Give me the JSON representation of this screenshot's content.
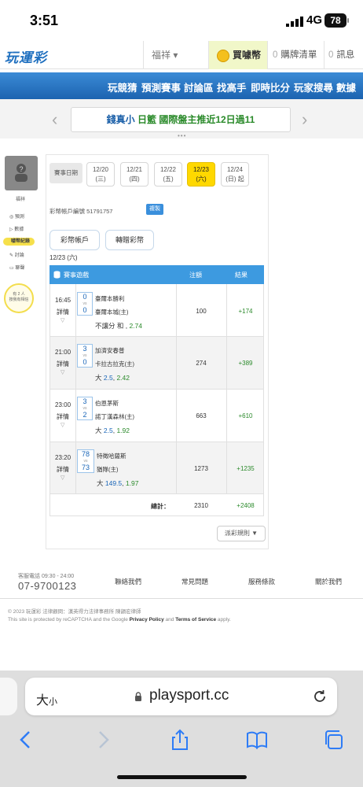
{
  "status_bar": {
    "time": "3:51",
    "network": "4G",
    "battery": "78"
  },
  "header": {
    "logo": "玩運彩",
    "user": "福祥 ▾",
    "buy_label": "買噱幣",
    "cart_count": "0",
    "cart_label": "購牌清單",
    "msg_count": "0",
    "msg_label": "訊息"
  },
  "nav": [
    "玩競猜",
    "預測賽事",
    "討論區",
    "找高手",
    "即時比分",
    "玩家搜尋",
    "數據"
  ],
  "banner": {
    "part1": "錢真小",
    "part2": " 日籃 國際盤主推近12日過11"
  },
  "sidebar": {
    "name": "福祥",
    "items": [
      "預測",
      "數據",
      "噱幣紀錄",
      "討論",
      "聊聲"
    ],
    "bulb_line1": "有 2 人",
    "bulb_line2": "按我有相信"
  },
  "content": {
    "tab_label": "賽事日期",
    "dates": [
      {
        "date": "12/20",
        "day": "(三)"
      },
      {
        "date": "12/21",
        "day": "(四)"
      },
      {
        "date": "12/22",
        "day": "(五)"
      },
      {
        "date": "12/23",
        "day": "(六)"
      },
      {
        "date": "12/24",
        "day": "(日) 起"
      }
    ],
    "account_label": "彩幣帳戶編號 51791757",
    "copy_label": "複製",
    "wallet_tabs": [
      "彩幣帳戶",
      "轉贈彩幣"
    ],
    "selected_date": "12/23 (六)",
    "table_headers": {
      "game": "賽事遊戲",
      "amount": "注額",
      "result": "結果"
    },
    "rows": [
      {
        "time": "16:45",
        "detail": "詳情",
        "score_a": "0",
        "score_b": "0",
        "team_a": "臺爾本勝利",
        "team_b": "臺爾本城(主)",
        "pick_label": "不讓分 和 , ",
        "pick_value": "2.74",
        "pick_line": "",
        "amount": "100",
        "result": "+174"
      },
      {
        "time": "21:00",
        "detail": "詳情",
        "score_a": "3",
        "score_b": "0",
        "team_a": "加濟安春普",
        "team_b": "卡拉古拉克(主)",
        "pick_label": "大 ",
        "pick_line": "2.5",
        "pick_value": "2.42",
        "amount": "274",
        "result": "+389"
      },
      {
        "time": "23:00",
        "detail": "詳情",
        "score_a": "3",
        "score_b": "2",
        "team_a": "伯恩茅斯",
        "team_b": "諾丁漢森林(主)",
        "pick_label": "大 ",
        "pick_line": "2.5",
        "pick_value": "1.92",
        "amount": "663",
        "result": "+610"
      },
      {
        "time": "23:20",
        "detail": "詳情",
        "score_a": "78",
        "score_b": "73",
        "team_a": "特徵哈薩斯",
        "team_b": "猶隊(主)",
        "pick_label": "大 ",
        "pick_line": "149.5",
        "pick_value": "1.97",
        "amount": "1273",
        "result": "+1235"
      }
    ],
    "total_label": "總計：",
    "total_amount": "2310",
    "total_result": "+2408",
    "rules_label": "派彩規則 ▼"
  },
  "footer": {
    "phone_label": "客服電話 09:30 - 24:00",
    "phone": "07-9700123",
    "links": [
      "聯絡我們",
      "常見問題",
      "服務條款",
      "關於我們"
    ],
    "copyright": "© 2023 玩運彩 法律顧問：漢英得力法律事務所 陳韻宏律師",
    "recaptcha_pre": "This site is protected by reCAPTCHA and the Google ",
    "privacy": "Privacy Policy",
    "and": " and ",
    "terms": "Terms of Service",
    "apply": " apply."
  },
  "safari": {
    "aa": "大",
    "aa_small": "小",
    "url": "playsport.cc"
  }
}
